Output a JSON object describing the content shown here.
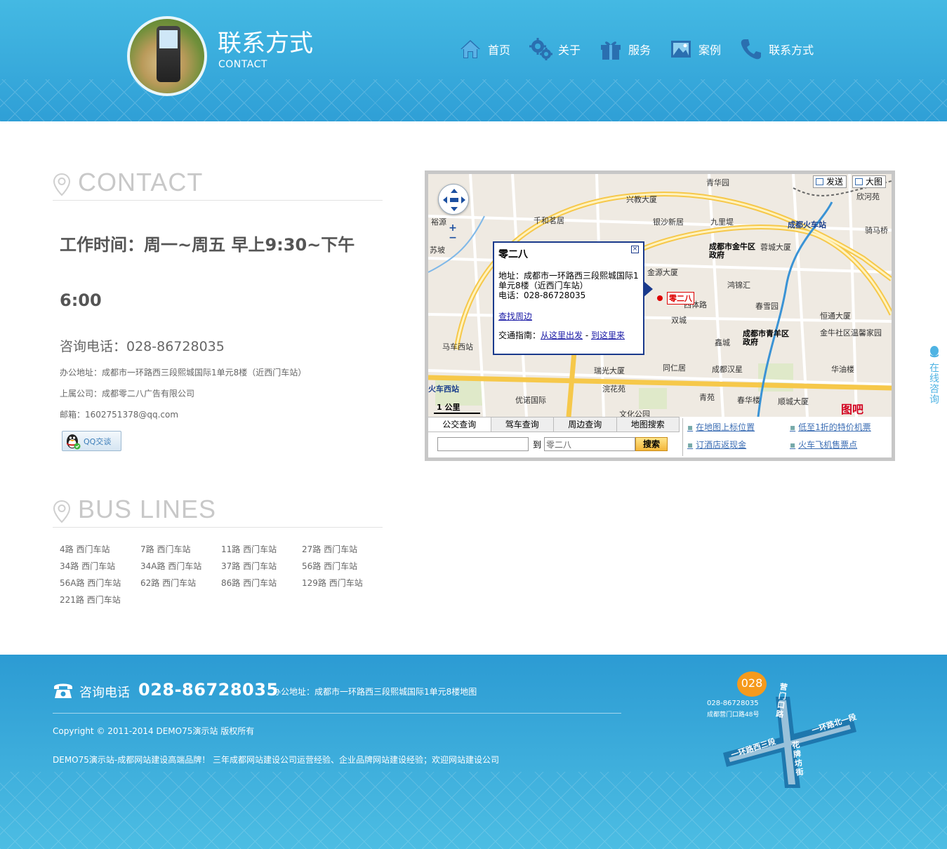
{
  "header": {
    "title": "联系方式",
    "subtitle": "CONTACT",
    "nav": [
      {
        "label": "首页",
        "icon": "home-icon"
      },
      {
        "label": "关于",
        "icon": "gears-icon"
      },
      {
        "label": "服务",
        "icon": "gift-icon"
      },
      {
        "label": "案例",
        "icon": "picture-icon"
      },
      {
        "label": "联系方式",
        "icon": "phone-icon"
      }
    ]
  },
  "contact": {
    "heading": "CONTACT",
    "hours": "工作时间：周一~周五 早上9:30~下午6:00",
    "phone": "咨询电话：028-86728035",
    "address": "办公地址：成都市一环路西三段熙城国际1单元8楼（近西门车站）",
    "company": "上属公司：成都零二八广告有限公司",
    "email": "邮箱：1602751378@qq.com",
    "qq_button": "QQ交谈"
  },
  "bus": {
    "heading": "BUS LINES",
    "lines": [
      "4路 西门车站",
      "7路 西门车站",
      "11路 西门车站",
      "27路 西门车站",
      "34路 西门车站",
      "34A路 西门车站",
      "37路 西门车站",
      "56路 西门车站",
      "56A路 西门车站",
      "62路 西门车站",
      "86路 西门车站",
      "129路 西门车站",
      "221路 西门车站"
    ]
  },
  "map": {
    "send_btn": "发送",
    "big_btn": "大图",
    "scale": "1 公里",
    "logo": "图吧",
    "infowin": {
      "title": "零二八",
      "address": "地址：成都市一环路西三段熙城国际1单元8楼（近西门车站）",
      "tel": "电话：028-86728035",
      "nearby": "查找周边",
      "guide_label": "交通指南：",
      "from_here": "从这里出发",
      "sep": " - ",
      "to_here": "到这里来"
    },
    "marker": "零二八",
    "labels": [
      "兴教大厦",
      "银沙新居",
      "九里堤",
      "成都火车站",
      "成都市金牛区政府",
      "蓉城大厦",
      "鸿锦汇",
      "春雪园",
      "恒通大厦",
      "金牛社区温馨家园",
      "双城",
      "鑫城",
      "成都汉星",
      "成都市青羊区政府",
      "瑞光大厦",
      "同仁居",
      "华油楼",
      "浣花苑",
      "优诺国际",
      "青苑",
      "春华楼",
      "顺城大厦",
      "文化公园",
      "青华园",
      "欣河苑",
      "千和茗居",
      "金源大厦",
      "西体路",
      "苏坡",
      "马车西站",
      "火车西站",
      "骑马桥",
      "裕源"
    ],
    "tabs": [
      "公交查询",
      "驾车查询",
      "周边查询",
      "地图搜索"
    ],
    "route_to": "到",
    "route_dest": "零二八",
    "search_btn": "搜索",
    "links": [
      "在地图上标位置",
      "低至1折的特价机票",
      "订酒店返现金",
      "火车飞机售票点"
    ]
  },
  "footer": {
    "tel_label": "咨询电话",
    "tel_number": "028-86728035",
    "address": "办公地址：成都市一环路西三段熙城国际1单元8楼地图",
    "copyright": "Copyright © 2011-2014 DEMO75演示站 版权所有",
    "slogan": "DEMO75演示站-成都网站建设高端品牌！ 三年成都网站建设公司运营经验、企业品牌网站建设经验；欢迎网站建设公司",
    "map_bubble": "028",
    "map_tel": "028-86728035",
    "map_addr": "成都营门口路48号",
    "map_roads": [
      "营门口路",
      "一环路北一段",
      "一环路西三段",
      "花牌坊街"
    ]
  },
  "side_tab": "在线咨询",
  "colors": {
    "header_blue": "#3aaddc",
    "footer_blue": "#3db0de",
    "accent_orange": "#f59a1d"
  }
}
